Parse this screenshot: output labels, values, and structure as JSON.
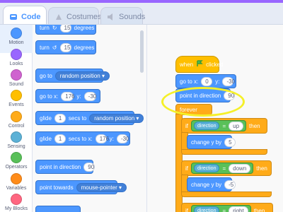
{
  "tabs": [
    {
      "label": "Code",
      "icon": "code-icon",
      "active": true
    },
    {
      "label": "Costumes",
      "icon": "costume-icon",
      "active": false
    },
    {
      "label": "Sounds",
      "icon": "speaker-icon",
      "active": false
    }
  ],
  "categories": [
    {
      "label": "Motion",
      "color": "#4c97ff"
    },
    {
      "label": "Looks",
      "color": "#9966ff"
    },
    {
      "label": "Sound",
      "color": "#cf63cf"
    },
    {
      "label": "Events",
      "color": "#ffbf00"
    },
    {
      "label": "Control",
      "color": "#ffab19"
    },
    {
      "label": "Sensing",
      "color": "#5cb1d6"
    },
    {
      "label": "Operators",
      "color": "#59c059"
    },
    {
      "label": "Variables",
      "color": "#ff8c1a"
    },
    {
      "label": "My Blocks",
      "color": "#ff6680"
    }
  ],
  "palette": {
    "turn_right": {
      "label": "turn",
      "value": "15",
      "suffix": "degrees"
    },
    "turn_left": {
      "label": "turn",
      "value": "15",
      "suffix": "degrees"
    },
    "go_to": {
      "label": "go to",
      "dropdown": "random position"
    },
    "go_to_xy": {
      "label": "go to x:",
      "x": "176",
      "ylabel": "y:",
      "y": "-30"
    },
    "glide_random": {
      "label": "glide",
      "value": "1",
      "mid": "secs to",
      "dropdown": "random position"
    },
    "glide_xy": {
      "label": "glide",
      "value": "1",
      "mid": "secs to x:",
      "x": "176",
      "ylabel": "y:",
      "y": "-30"
    },
    "point_dir": {
      "label": "point in direction",
      "value": "90"
    },
    "point_towards": {
      "label": "point towards",
      "dropdown": "mouse-pointer"
    }
  },
  "script": {
    "hat": "when",
    "hat_suffix": "clicked",
    "goto": {
      "label": "go to x:",
      "x": "0",
      "ylabel": "y:",
      "y": "-30"
    },
    "point": {
      "label": "point in direction",
      "value": "90"
    },
    "forever": "forever",
    "if1": {
      "label": "if",
      "left": "direction",
      "op": "=",
      "right": "up",
      "then": "then"
    },
    "change1": {
      "label": "change y by",
      "value": "5"
    },
    "if2": {
      "label": "if",
      "left": "direction",
      "op": "=",
      "right": "down",
      "then": "then"
    },
    "change2": {
      "label": "change y by",
      "value": "-5"
    },
    "if3": {
      "label": "if",
      "left": "direction",
      "op": "=",
      "right": "right",
      "then": "then"
    }
  }
}
